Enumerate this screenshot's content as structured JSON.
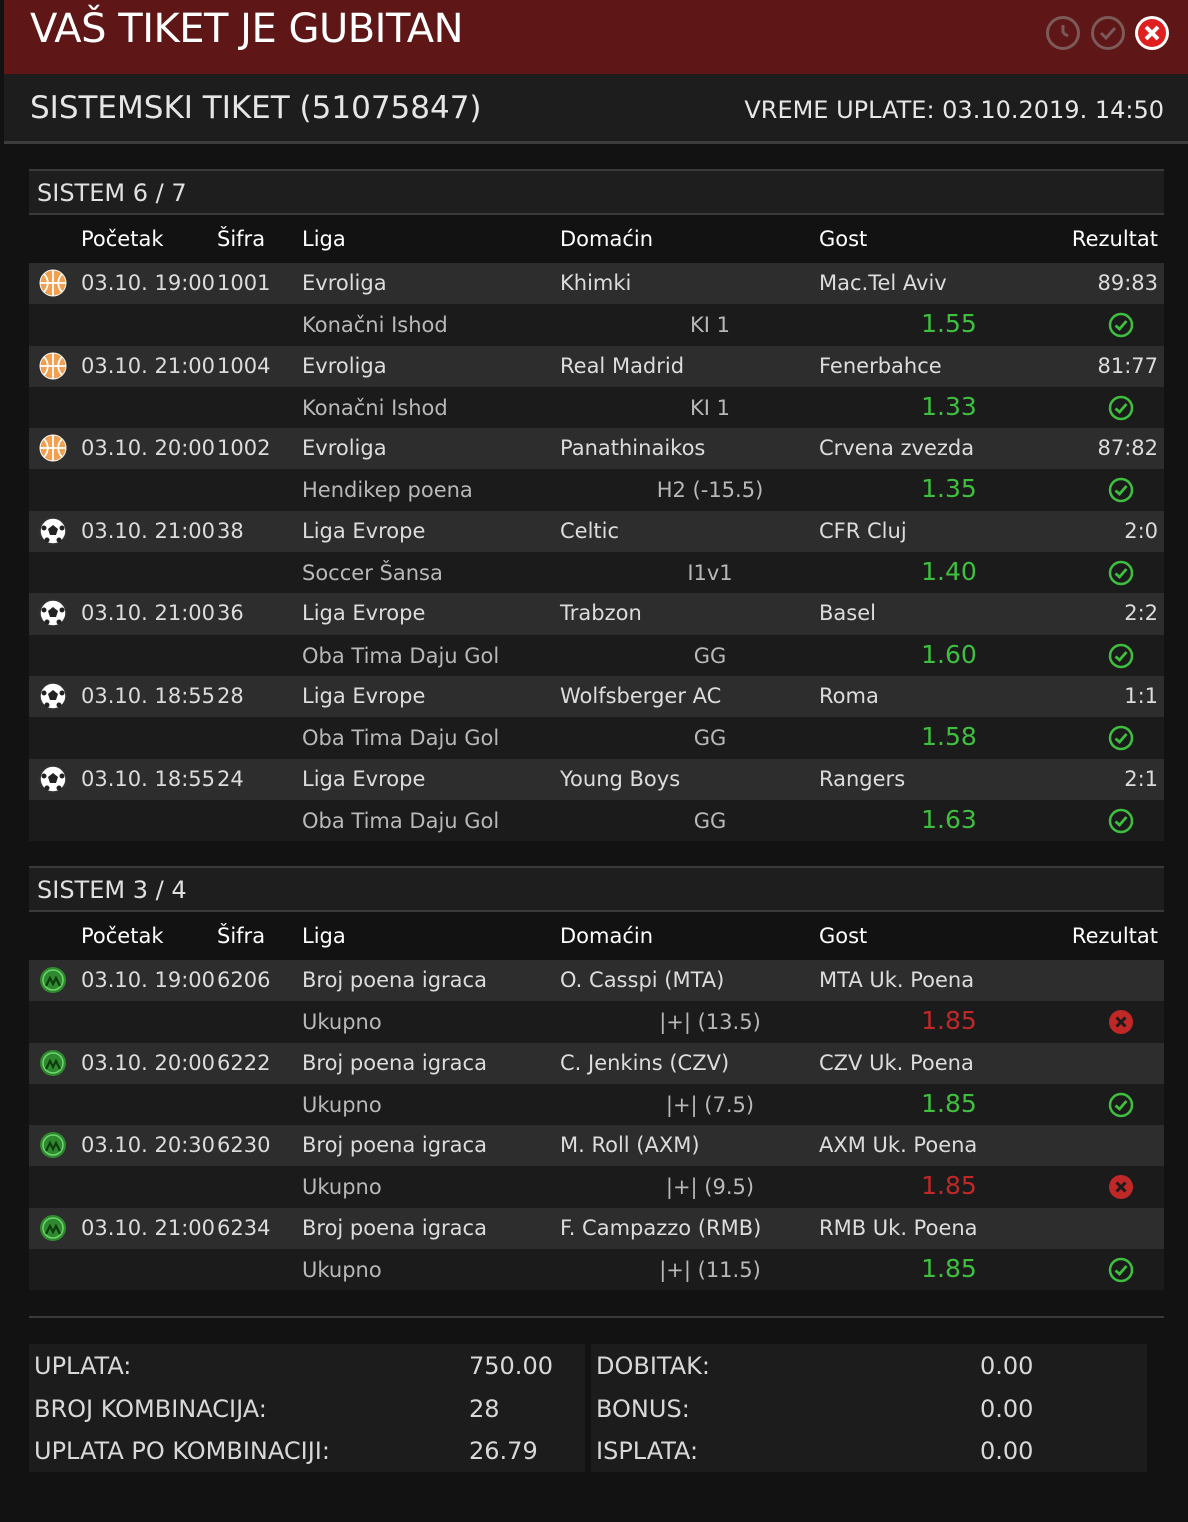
{
  "window": {
    "title": "VAŠ TIKET JE GUBITAN"
  },
  "header": {
    "ticket": "SISTEMSKI TIKET (51075847)",
    "payment_time": "VREME UPLATE: 03.10.2019. 14:50"
  },
  "columns": {
    "start": "Početak",
    "code": "Šifra",
    "league": "Liga",
    "home": "Domaćin",
    "away": "Gost",
    "result": "Rezultat"
  },
  "colors": {
    "win": "#3fbf3f",
    "lose": "#c02828",
    "titlebar": "#5e1616"
  },
  "system1": {
    "title": "SISTEM 6 / 7",
    "rows": [
      {
        "sport": "basketball-icon",
        "start": "03.10. 19:00",
        "code": "1001",
        "league": "Evroliga",
        "home": "Khimki",
        "away": "Mac.Tel Aviv",
        "result": "89:83",
        "market": "Konačni Ishod",
        "tip": "KI 1",
        "odd": "1.55",
        "status": "win"
      },
      {
        "sport": "basketball-icon",
        "start": "03.10. 21:00",
        "code": "1004",
        "league": "Evroliga",
        "home": "Real Madrid",
        "away": "Fenerbahce",
        "result": "81:77",
        "market": "Konačni Ishod",
        "tip": "KI 1",
        "odd": "1.33",
        "status": "win"
      },
      {
        "sport": "basketball-icon",
        "start": "03.10. 20:00",
        "code": "1002",
        "league": "Evroliga",
        "home": "Panathinaikos",
        "away": "Crvena zvezda",
        "result": "87:82",
        "market": "Hendikep poena",
        "tip": "H2 (-15.5)",
        "odd": "1.35",
        "status": "win"
      },
      {
        "sport": "football-icon",
        "start": "03.10. 21:00",
        "code": "38",
        "league": "Liga Evrope",
        "home": "Celtic",
        "away": "CFR Cluj",
        "result": "2:0",
        "market": "Soccer Šansa",
        "tip": "I1v1",
        "odd": "1.40",
        "status": "win"
      },
      {
        "sport": "football-icon",
        "start": "03.10. 21:00",
        "code": "36",
        "league": "Liga Evrope",
        "home": "Trabzon",
        "away": "Basel",
        "result": "2:2",
        "market": "Oba Tima Daju Gol",
        "tip": "GG",
        "odd": "1.60",
        "status": "win"
      },
      {
        "sport": "football-icon",
        "start": "03.10. 18:55",
        "code": "28",
        "league": "Liga Evrope",
        "home": "Wolfsberger AC",
        "away": "Roma",
        "result": "1:1",
        "market": "Oba Tima Daju Gol",
        "tip": "GG",
        "odd": "1.58",
        "status": "win"
      },
      {
        "sport": "football-icon",
        "start": "03.10. 18:55",
        "code": "24",
        "league": "Liga Evrope",
        "home": "Young Boys",
        "away": "Rangers",
        "result": "2:1",
        "market": "Oba Tima Daju Gol",
        "tip": "GG",
        "odd": "1.63",
        "status": "win"
      }
    ]
  },
  "system2": {
    "title": "SISTEM 3 / 4",
    "rows": [
      {
        "sport": "player-specials-icon",
        "start": "03.10. 19:00",
        "code": "6206",
        "league": "Broj poena igraca",
        "home": "O. Casspi (MTA)",
        "away": "MTA Uk. Poena",
        "result": "",
        "market": "Ukupno",
        "tip": "|+| (13.5)",
        "odd": "1.85",
        "status": "lose"
      },
      {
        "sport": "player-specials-icon",
        "start": "03.10. 20:00",
        "code": "6222",
        "league": "Broj poena igraca",
        "home": "C. Jenkins (CZV)",
        "away": "CZV Uk. Poena",
        "result": "",
        "market": "Ukupno",
        "tip": "|+| (7.5)",
        "odd": "1.85",
        "status": "win"
      },
      {
        "sport": "player-specials-icon",
        "start": "03.10. 20:30",
        "code": "6230",
        "league": "Broj poena igraca",
        "home": "M. Roll (AXM)",
        "away": "AXM Uk. Poena",
        "result": "",
        "market": "Ukupno",
        "tip": "|+| (9.5)",
        "odd": "1.85",
        "status": "lose"
      },
      {
        "sport": "player-specials-icon",
        "start": "03.10. 21:00",
        "code": "6234",
        "league": "Broj poena igraca",
        "home": "F. Campazzo (RMB)",
        "away": "RMB Uk. Poena",
        "result": "",
        "market": "Ukupno",
        "tip": "|+| (11.5)",
        "odd": "1.85",
        "status": "win"
      }
    ]
  },
  "summary": {
    "left": [
      {
        "label": "UPLATA:",
        "value": "750.00"
      },
      {
        "label": "BROJ KOMBINACIJA:",
        "value": "28"
      },
      {
        "label": "UPLATA PO KOMBINACIJI:",
        "value": "26.79"
      }
    ],
    "right": [
      {
        "label": "DOBITAK:",
        "value": "0.00"
      },
      {
        "label": "BONUS:",
        "value": "0.00"
      },
      {
        "label": "ISPLATA:",
        "value": "0.00"
      }
    ]
  }
}
